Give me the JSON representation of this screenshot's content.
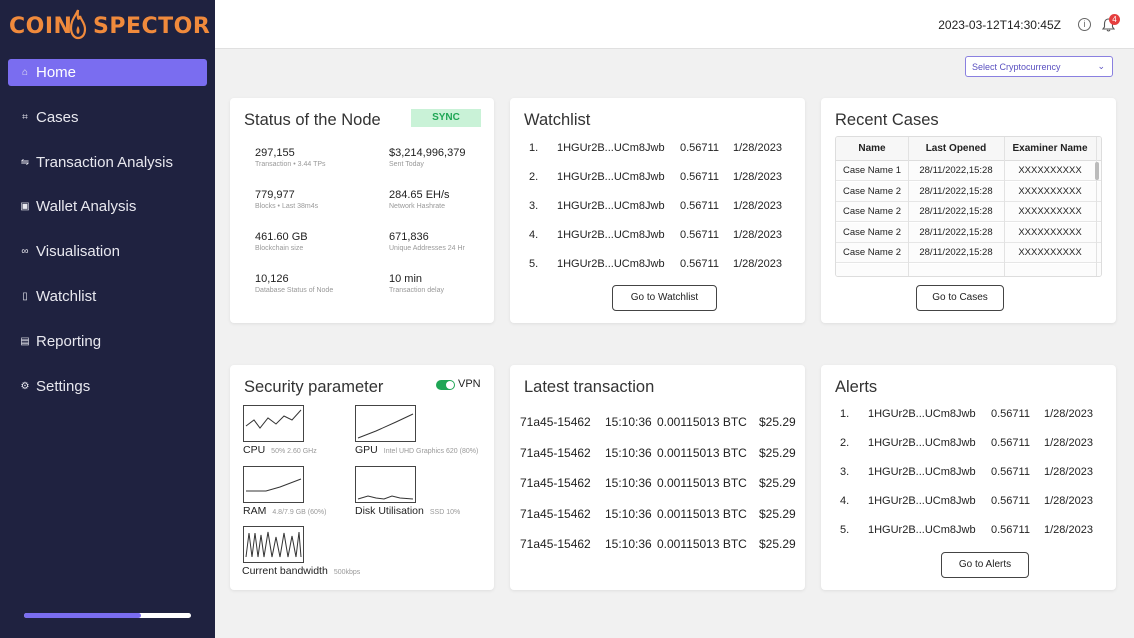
{
  "brand": {
    "logo_left": "COIN",
    "logo_right": "SPECTOR",
    "accent": "#7a6df0",
    "sidebar_bg": "#1f2240",
    "logo_color": "#f08a3c"
  },
  "sidebar": {
    "items": [
      {
        "label": "Home",
        "icon": "home-icon",
        "glyph": "⌂",
        "active": true
      },
      {
        "label": "Cases",
        "icon": "cases-icon",
        "glyph": "⌗"
      },
      {
        "label": "Transaction Analysis",
        "icon": "transaction-analysis-icon",
        "glyph": "⇋"
      },
      {
        "label": "Wallet Analysis",
        "icon": "wallet-icon",
        "glyph": "▣"
      },
      {
        "label": "Visualisation",
        "icon": "link-icon",
        "glyph": "∞"
      },
      {
        "label": "Watchlist",
        "icon": "bookmark-icon",
        "glyph": "▯"
      },
      {
        "label": "Reporting",
        "icon": "report-icon",
        "glyph": "▤"
      },
      {
        "label": "Settings",
        "icon": "gear-icon",
        "glyph": "⚙"
      }
    ],
    "progress": 0.7
  },
  "header": {
    "timestamp": "2023-03-12T14:30:45Z",
    "notification_count": "4"
  },
  "crypto_select": {
    "placeholder": "Select Cryptocurrency"
  },
  "node_status": {
    "title": "Status of the Node",
    "badge": "SYNC",
    "stats": [
      {
        "value": "297,155",
        "label": "Transaction • 3.44 TPs"
      },
      {
        "value": "$3,214,996,379",
        "label": "Sent Today"
      },
      {
        "value": "779,977",
        "label": "Blocks • Last 38m4s"
      },
      {
        "value": "284.65 EH/s",
        "label": "Network Hashrate"
      },
      {
        "value": "461.60 GB",
        "label": "Blockchain size"
      },
      {
        "value": "671,836",
        "label": "Unique Addresses 24 Hr"
      },
      {
        "value": "10,126",
        "label": "Database Status of Node"
      },
      {
        "value": "10 min",
        "label": "Transaction delay"
      }
    ]
  },
  "watchlist": {
    "title": "Watchlist",
    "rows": [
      {
        "n": "1.",
        "addr": "1HGUr2B...UCm8Jwb",
        "val": "0.56711",
        "date": "1/28/2023"
      },
      {
        "n": "2.",
        "addr": "1HGUr2B...UCm8Jwb",
        "val": "0.56711",
        "date": "1/28/2023"
      },
      {
        "n": "3.",
        "addr": "1HGUr2B...UCm8Jwb",
        "val": "0.56711",
        "date": "1/28/2023"
      },
      {
        "n": "4.",
        "addr": "1HGUr2B...UCm8Jwb",
        "val": "0.56711",
        "date": "1/28/2023"
      },
      {
        "n": "5.",
        "addr": "1HGUr2B...UCm8Jwb",
        "val": "0.56711",
        "date": "1/28/2023"
      }
    ],
    "button": "Go to Watchlist"
  },
  "recent_cases": {
    "title": "Recent Cases",
    "columns": [
      "Name",
      "Last Opened",
      "Examiner Name"
    ],
    "rows": [
      [
        "Case Name 1",
        "28/11/2022,15:28",
        "XXXXXXXXXX"
      ],
      [
        "Case Name 2",
        "28/11/2022,15:28",
        "XXXXXXXXXX"
      ],
      [
        "Case Name 2",
        "28/11/2022,15:28",
        "XXXXXXXXXX"
      ],
      [
        "Case Name 2",
        "28/11/2022,15:28",
        "XXXXXXXXXX"
      ],
      [
        "Case Name 2",
        "28/11/2022,15:28",
        "XXXXXXXXXX"
      ]
    ],
    "button": "Go to Cases"
  },
  "security": {
    "title": "Security parameter",
    "vpn_label": "VPN",
    "vpn_on": true,
    "metrics": [
      {
        "name": "CPU",
        "detail": "50%  2.60 GHz"
      },
      {
        "name": "GPU",
        "detail": "Intel UHD Graphics 620  (80%)"
      },
      {
        "name": "RAM",
        "detail": "4.8/7.9 GB  (60%)"
      },
      {
        "name": "Disk Utilisation",
        "detail": "SSD 10%"
      },
      {
        "name": "Current bandwidth",
        "detail": "500kbps"
      }
    ]
  },
  "latest_tx": {
    "title": "Latest transaction",
    "rows": [
      {
        "id": "71a45-15462",
        "time": "15:10:36",
        "btc": "0.00115013 BTC",
        "usd": "$25.29"
      },
      {
        "id": "71a45-15462",
        "time": "15:10:36",
        "btc": "0.00115013 BTC",
        "usd": "$25.29"
      },
      {
        "id": "71a45-15462",
        "time": "15:10:36",
        "btc": "0.00115013 BTC",
        "usd": "$25.29"
      },
      {
        "id": "71a45-15462",
        "time": "15:10:36",
        "btc": "0.00115013 BTC",
        "usd": "$25.29"
      },
      {
        "id": "71a45-15462",
        "time": "15:10:36",
        "btc": "0.00115013 BTC",
        "usd": "$25.29"
      }
    ]
  },
  "alerts": {
    "title": "Alerts",
    "rows": [
      {
        "n": "1.",
        "addr": "1HGUr2B...UCm8Jwb",
        "val": "0.56711",
        "date": "1/28/2023"
      },
      {
        "n": "2.",
        "addr": "1HGUr2B...UCm8Jwb",
        "val": "0.56711",
        "date": "1/28/2023"
      },
      {
        "n": "3.",
        "addr": "1HGUr2B...UCm8Jwb",
        "val": "0.56711",
        "date": "1/28/2023"
      },
      {
        "n": "4.",
        "addr": "1HGUr2B...UCm8Jwb",
        "val": "0.56711",
        "date": "1/28/2023"
      },
      {
        "n": "5.",
        "addr": "1HGUr2B...UCm8Jwb",
        "val": "0.56711",
        "date": "1/28/2023"
      }
    ],
    "button": "Go to Alerts"
  }
}
